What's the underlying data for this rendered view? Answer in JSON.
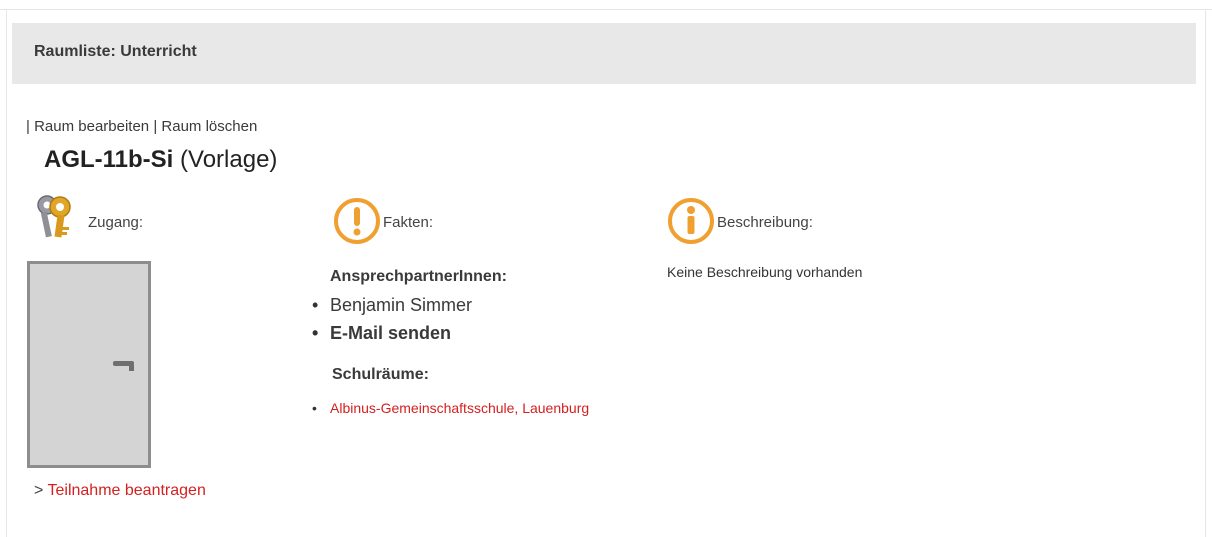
{
  "page": {
    "header_title": "Raumliste: Unterricht",
    "actions": {
      "separator": "|",
      "edit_label": "Raum bearbeiten",
      "delete_label": "Raum löschen"
    },
    "room": {
      "name": "AGL-11b-Si",
      "tag": "(Vorlage)"
    },
    "columns": {
      "access": {
        "label": "Zugang:",
        "icon": "keys-icon"
      },
      "facts": {
        "label": "Fakten:",
        "icon": "exclamation-icon"
      },
      "description": {
        "label": "Beschreibung:",
        "icon": "info-icon"
      }
    },
    "access": {
      "door_icon": "door-icon",
      "request_prefix": ">",
      "request_label": "Teilnahme beantragen"
    },
    "facts": {
      "contacts_heading": "AnsprechpartnerInnen:",
      "contact_name": "Benjamin Simmer",
      "contact_email_label": "E-Mail senden",
      "schools_heading": "Schulräume:",
      "school_link": "Albinus-Gemeinschaftsschule, Lauenburg"
    },
    "description": {
      "text": "Keine Beschreibung vorhanden"
    },
    "colors": {
      "accent_orange": "#f0a030",
      "link_red": "#d42020",
      "header_bg": "#e8e8e8"
    }
  }
}
